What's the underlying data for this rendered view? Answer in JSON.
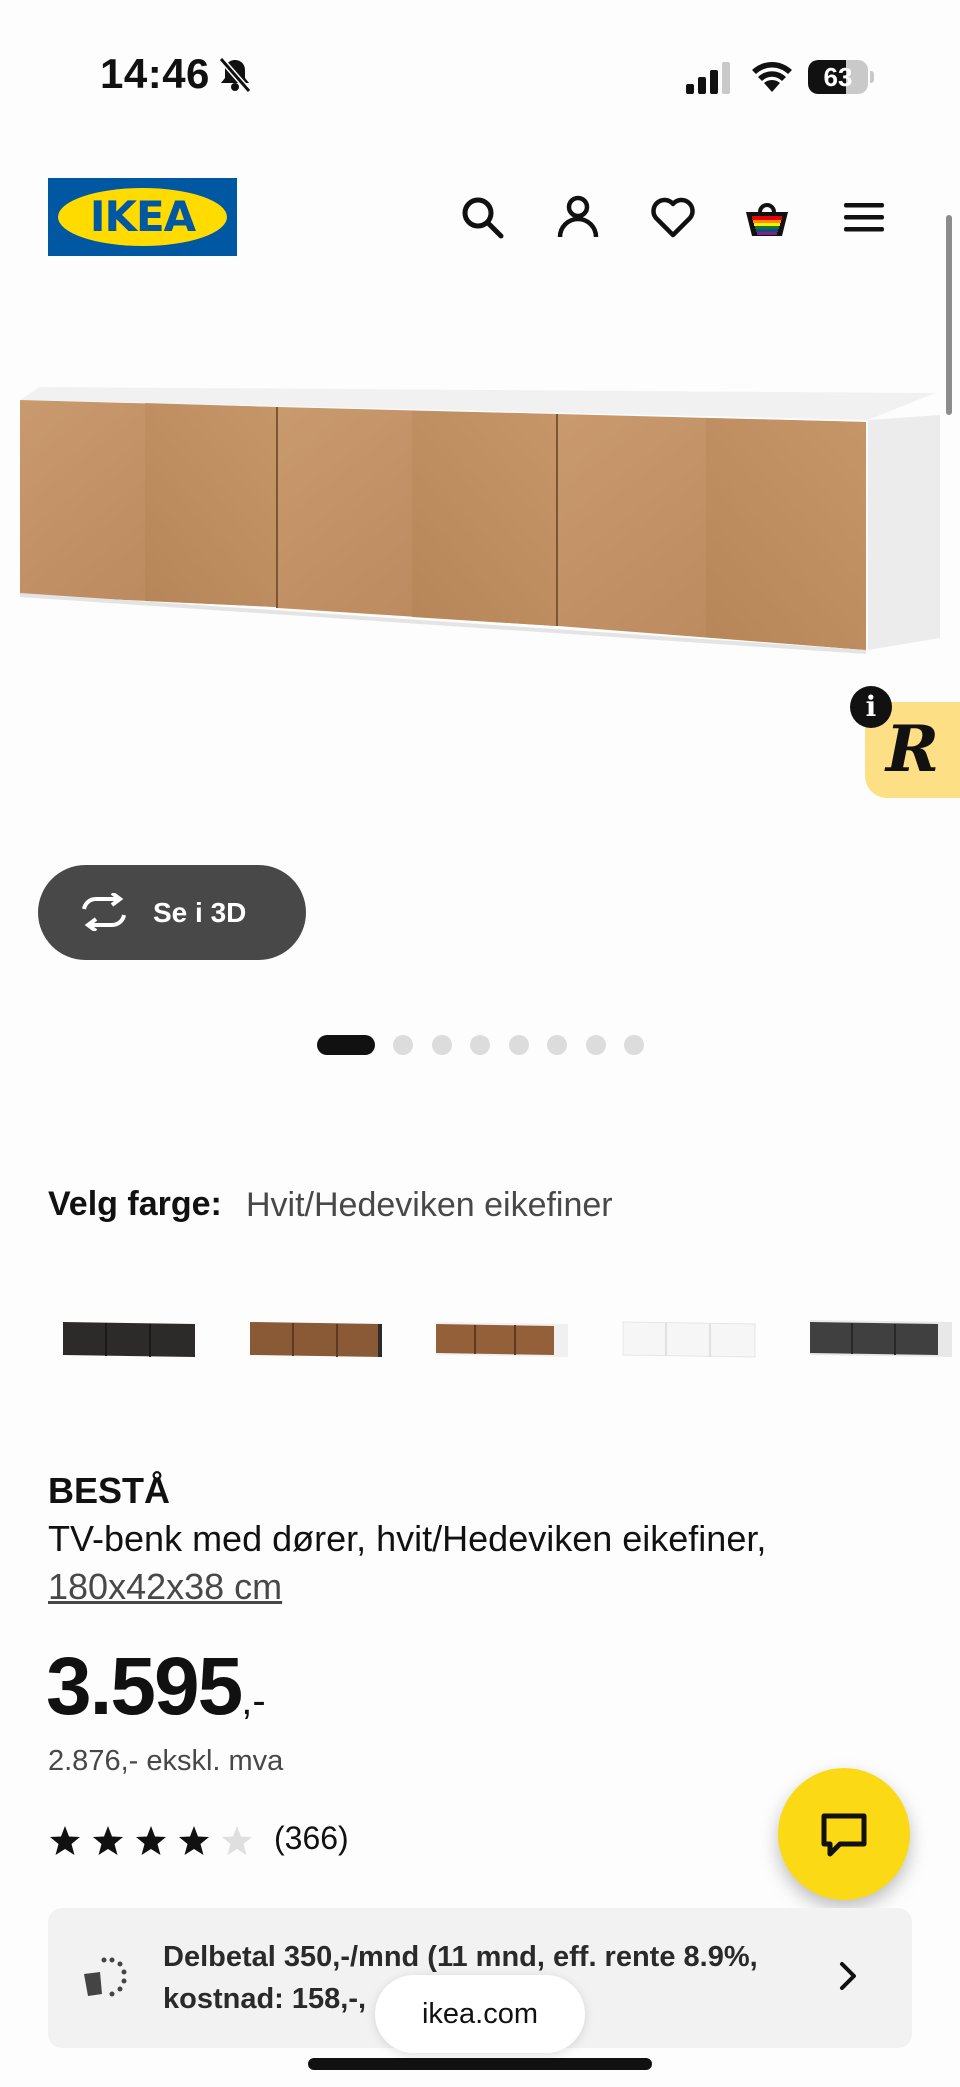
{
  "status_bar": {
    "time": "14:46",
    "battery": "63",
    "battery_level": 0.63
  },
  "header": {
    "logo_text": "IKEA",
    "icons": [
      "search-icon",
      "account-icon",
      "heart-icon",
      "cart-icon",
      "menu-icon"
    ]
  },
  "gallery": {
    "view_3d_label": "Se i 3D",
    "badge_letter": "R",
    "info_letter": "i",
    "slide_count": 8,
    "active_slide": 1
  },
  "color": {
    "label": "Velg farge:",
    "value": "Hvit/Hedeviken eikefiner",
    "swatches": [
      "black-brown",
      "walnut-black",
      "walnut-white",
      "white",
      "dark-grey"
    ]
  },
  "product": {
    "brand": "BESTÅ",
    "description": "TV-benk med dører, hvit/Hedeviken eikefiner,",
    "size": "180x42x38 cm",
    "price_main": "3.595",
    "price_suffix": ",-",
    "price_ex_vat": "2.876,- ekskl. mva",
    "rating": 4,
    "rating_count": "(366)"
  },
  "finance": {
    "line1": "Delbetal 350,-/mnd (11 mnd, eff. rente 8.9%,",
    "line2": "kostnad: 158,-,"
  },
  "browser": {
    "url": "ikea.com"
  },
  "colors": {
    "ikea_blue": "#0058a3",
    "ikea_yellow": "#ffdb00",
    "chat_yellow": "#fbd914",
    "dark_button": "#484848"
  }
}
